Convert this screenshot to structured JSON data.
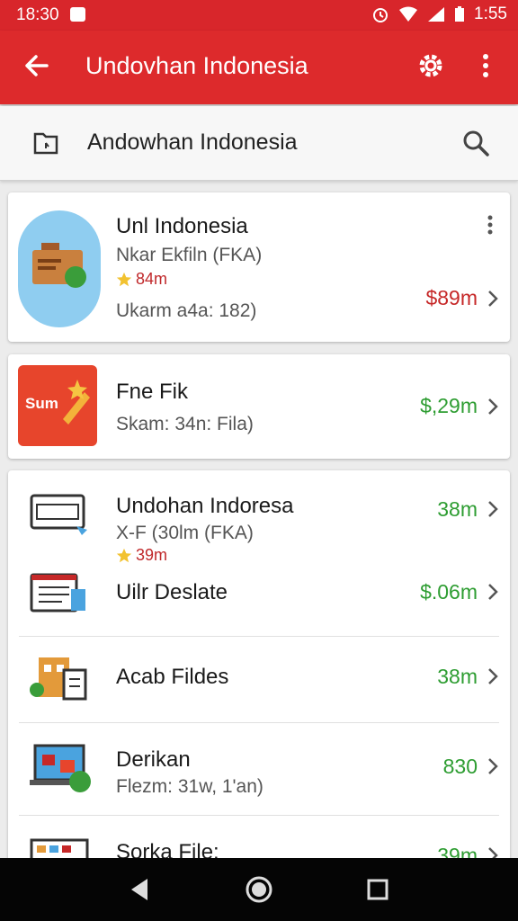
{
  "status_bar": {
    "time": "18:30",
    "clock": "1:55"
  },
  "app_bar": {
    "title": "Undovhan Indonesia"
  },
  "search": {
    "text": "Andowhan  Indonesia"
  },
  "card1": {
    "title": "Unl Indonesia",
    "subtitle": "Nkar Ekfiln (FKA)",
    "rating": "84m",
    "meta": "Ukarm a4a: 182)",
    "price": "$89m",
    "price_color": "#c62828"
  },
  "card2": {
    "title": "Fne Fik",
    "subtitle": "Skam: 34n: Fila)",
    "price": "$,29m",
    "price_color": "#2e9d32",
    "icon_text": "Sum"
  },
  "list": [
    {
      "title": "Undohan Indoresa",
      "subtitle": "X-F (30lm (FKA)",
      "rating": "39m",
      "price": "38m"
    },
    {
      "title": "Uilr Deslate",
      "price": "$.06m"
    },
    {
      "title": "Acab Fildes",
      "price": "38m"
    },
    {
      "title": "Derikan",
      "subtitle": "Flezm: 31w, 1'an)",
      "price": "830"
    },
    {
      "title": "Sorka File:",
      "price": "39m"
    }
  ],
  "icons": [
    "back-arrow-icon",
    "settings-icon",
    "more-vert-icon",
    "folder-icon",
    "search-icon",
    "chevron-right-icon",
    "star-icon"
  ]
}
